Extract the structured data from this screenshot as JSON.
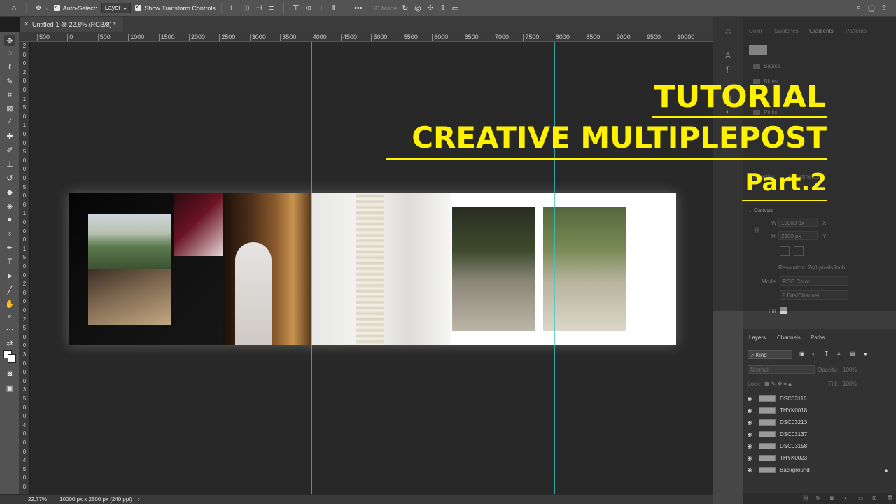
{
  "options_bar": {
    "auto_select_label": "Auto-Select:",
    "auto_select_value": "Layer",
    "show_transform_label": "Show Transform Controls",
    "mode_3d_label": "3D Mode:"
  },
  "document_tab": {
    "title": "Untitled-1 @ 22,8% (RGB/8) *"
  },
  "ruler_h": [
    "500",
    "0",
    "500",
    "1000",
    "1500",
    "2000",
    "2500",
    "3000",
    "3500",
    "4000",
    "4500",
    "5000",
    "5500",
    "6000",
    "6500",
    "7000",
    "7500",
    "8000",
    "8500",
    "9000",
    "9500",
    "10000"
  ],
  "ruler_v": [
    "2",
    "0",
    "0",
    "2",
    "0",
    "0",
    "1",
    "5",
    "0",
    "1",
    "0",
    "0",
    "5",
    "0",
    "0",
    "0",
    "5",
    "0",
    "0",
    "1",
    "0",
    "0",
    "0",
    "1",
    "5",
    "0",
    "0",
    "2",
    "0",
    "0",
    "0",
    "2",
    "5",
    "0",
    "0",
    "3",
    "0",
    "0",
    "0",
    "3",
    "5",
    "0",
    "0",
    "4",
    "0",
    "0",
    "0",
    "4",
    "5",
    "0",
    "0"
  ],
  "overlay": {
    "line1": "TUTORIAL",
    "line2": "CREATIVE MULTIPLEPOST",
    "line3": "Part.2"
  },
  "status_bar": {
    "zoom": "22,77%",
    "doc_info": "10000 px x 2500 px (240 ppi)"
  },
  "panels": {
    "top_tabs": [
      "Color",
      "Swatches",
      "Gradients",
      "Patterns"
    ],
    "gradient_folders": [
      "Basics",
      "Blues",
      "Pinks"
    ],
    "properties_tabs": [
      "Properties",
      "Adjustments"
    ],
    "properties": {
      "section": "Canvas",
      "w_label": "W",
      "w_value": "10000 px",
      "x_label": "X",
      "h_label": "H",
      "h_value": "2500 px",
      "y_label": "Y",
      "resolution": "Resolution: 240 pixels/inch",
      "mode_label": "Mode",
      "mode_value": "RGB Color",
      "bits_value": "8 Bits/Channel",
      "fill_label": "Fill"
    },
    "layers_tabs": [
      "Layers",
      "Channels",
      "Paths"
    ],
    "kind_label": "Kind",
    "blend_mode": "Normal",
    "opacity_label": "Opacity:",
    "opacity_value": "100%",
    "lock_label": "Lock:",
    "fill_label": "Fill:",
    "fill_value": "100%",
    "layers": [
      "DSC03116",
      "THYK0018",
      "DSC03213",
      "DSC03137",
      "DSC03158",
      "THYK0023",
      "Background"
    ]
  },
  "colors": {
    "accent_title": "#fff200",
    "guide": "#37c8c8",
    "workspace": "#282828",
    "chrome": "#535353"
  }
}
